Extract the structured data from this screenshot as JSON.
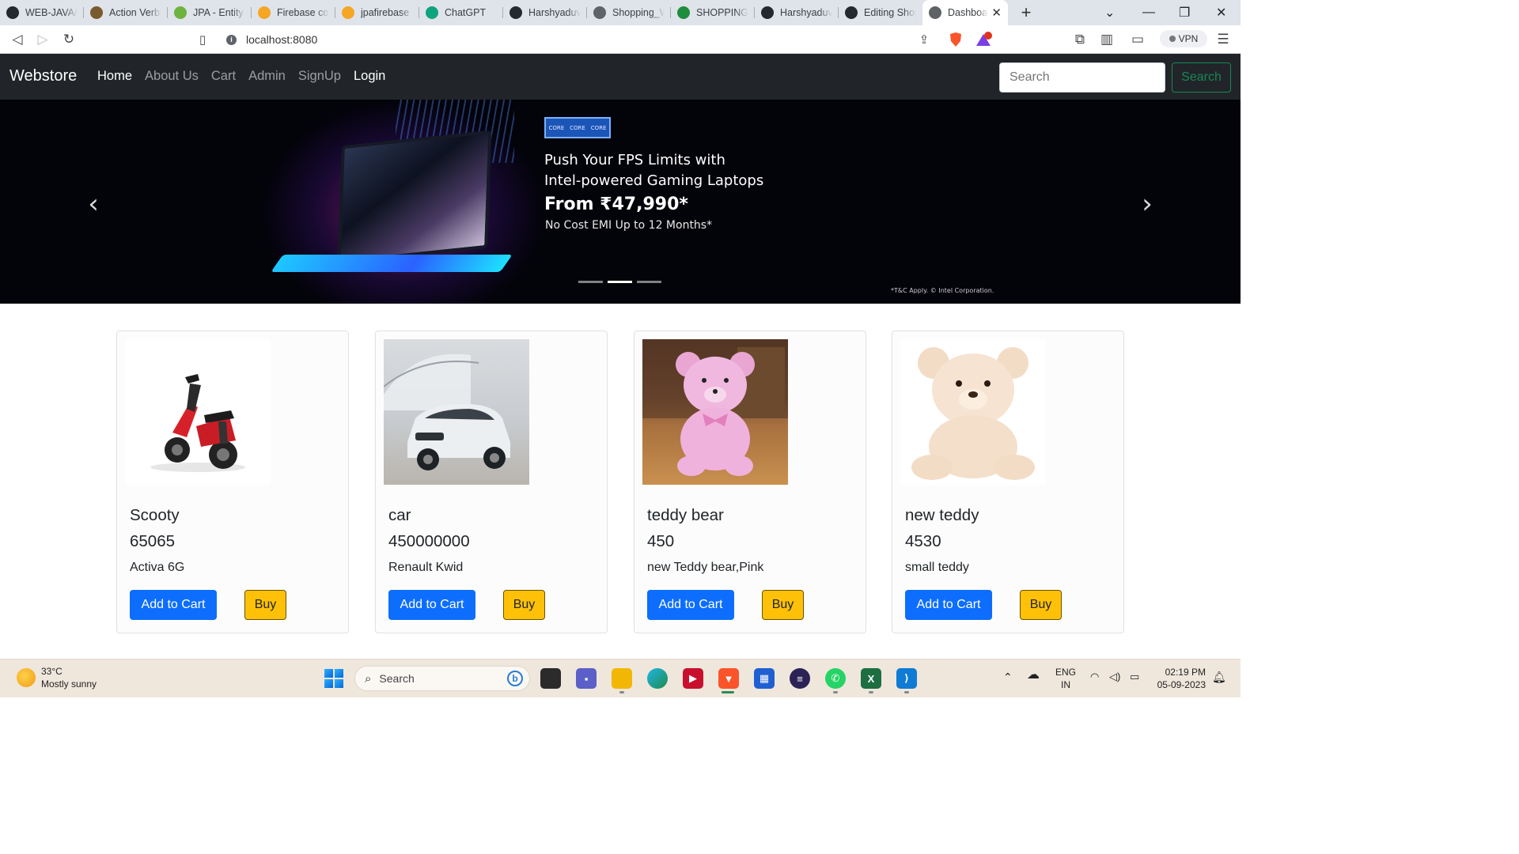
{
  "browser": {
    "tabs": [
      {
        "title": "WEB-JAVA/W",
        "icon": "github-icon",
        "color": "#24292f"
      },
      {
        "title": "Action Verbs",
        "icon": "document-icon",
        "color": "#7a5b2f"
      },
      {
        "title": "JPA - Entity R",
        "icon": "spring-icon",
        "color": "#6db33f"
      },
      {
        "title": "Firebase con",
        "icon": "firebase-icon",
        "color": "#f5a623"
      },
      {
        "title": "jpafirebase -",
        "icon": "firebase-icon",
        "color": "#f5a623"
      },
      {
        "title": "ChatGPT",
        "icon": "chatgpt-icon",
        "color": "#10a37f"
      },
      {
        "title": "Harshyaduva",
        "icon": "github-icon",
        "color": "#24292f"
      },
      {
        "title": "Shopping_W",
        "icon": "globe-icon",
        "color": "#5f6368"
      },
      {
        "title": "SHOPPING A",
        "icon": "drive-icon",
        "color": "#1e8e3e"
      },
      {
        "title": "Harshyaduva",
        "icon": "github-icon",
        "color": "#24292f"
      },
      {
        "title": "Editing Shop",
        "icon": "github-icon",
        "color": "#24292f"
      },
      {
        "title": "Dashboa",
        "icon": "globe-icon",
        "color": "#5f6368",
        "active": true
      }
    ],
    "close_tab": "✕",
    "new_tab": "+",
    "url": "localhost:8080",
    "vpn_label": "VPN"
  },
  "nav": {
    "brand": "Webstore",
    "links": [
      "Home",
      "About Us",
      "Cart",
      "Admin",
      "SignUp",
      "Login"
    ],
    "search_placeholder": "Search",
    "search_button": "Search"
  },
  "carousel": {
    "badge": [
      "CORE",
      "CORE",
      "CORE"
    ],
    "line1": "Push Your FPS Limits with",
    "line2": "Intel-powered Gaming Laptops",
    "line3": "From ₹47,990*",
    "line4": "No Cost EMI Up to 12 Months*",
    "disclaimer": "*T&C Apply. © Intel Corporation.",
    "prev": "‹",
    "next": "›",
    "slide_count": 3,
    "active_slide": 2
  },
  "products": [
    {
      "name": "Scooty",
      "price": "65065",
      "description": "Activa 6G",
      "add_label": "Add to Cart",
      "buy_label": "Buy"
    },
    {
      "name": "car",
      "price": "450000000",
      "description": "Renault Kwid",
      "add_label": "Add to Cart",
      "buy_label": "Buy"
    },
    {
      "name": "teddy bear",
      "price": "450",
      "description": "new Teddy bear,Pink",
      "add_label": "Add to Cart",
      "buy_label": "Buy"
    },
    {
      "name": "new teddy",
      "price": "4530",
      "description": "small teddy",
      "add_label": "Add to Cart",
      "buy_label": "Buy"
    }
  ],
  "taskbar": {
    "weather_temp": "33°C",
    "weather_desc": "Mostly sunny",
    "search_placeholder": "Search",
    "lang_top": "ENG",
    "lang_bottom": "IN",
    "time": "02:19 PM",
    "date": "05-09-2023"
  },
  "colors": {
    "navbar": "#212529",
    "primary": "#0d6efd",
    "warning": "#ffc107",
    "success": "#198754"
  }
}
